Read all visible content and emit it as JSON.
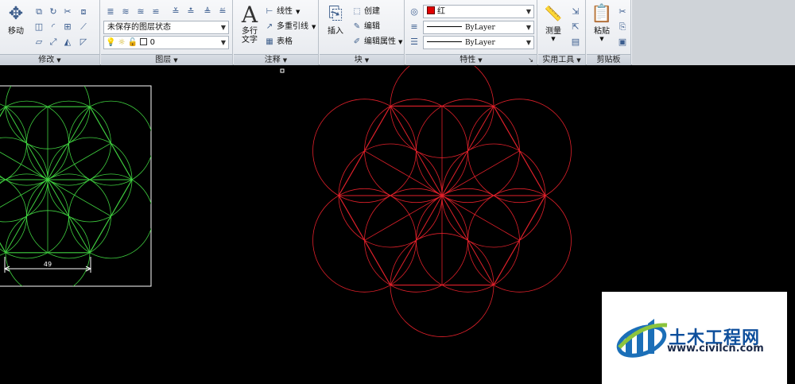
{
  "ribbon": {
    "modify": {
      "move_label": "移动",
      "footer": "修改"
    },
    "layers": {
      "layer_state": "未保存的图层状态",
      "current_layer": "0",
      "footer": "图层"
    },
    "annotation": {
      "multiline_text_line1": "多行",
      "multiline_text_line2": "文字",
      "linear_label": "线性",
      "multileader_label": "多重引线",
      "table_label": "表格",
      "footer": "注释"
    },
    "block": {
      "insert_label": "插入",
      "create_label": "创建",
      "edit_label": "编辑",
      "edit_attributes_label": "编辑属性",
      "footer": "块"
    },
    "properties": {
      "color_value": "红",
      "linetype_value": "ByLayer",
      "lineweight_value": "ByLayer",
      "footer": "特性"
    },
    "utilities": {
      "measure_label": "测量",
      "footer": "实用工具"
    },
    "clipboard": {
      "paste_label": "粘贴",
      "footer": "剪贴板"
    }
  },
  "drawing": {
    "dimension_value": "49",
    "colors": {
      "green_pattern": "#3fcf3f",
      "red_pattern": "#e0202a",
      "viewport_border": "#ffffff"
    }
  },
  "watermark": {
    "name": "土木工程网",
    "url": "www.civilcn.com"
  }
}
